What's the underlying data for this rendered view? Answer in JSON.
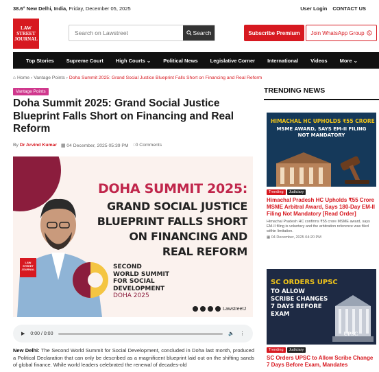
{
  "topbar": {
    "weather": "38.6° New Delhi, India,",
    "date": " Friday, December 05, 2025",
    "user_login": "User Login",
    "contact_us": "CONTACT US"
  },
  "logo": {
    "line1": "LAW",
    "line2": "STREET",
    "line3": "JOURNAL"
  },
  "search": {
    "placeholder": "Search on Lawstreet",
    "button": "Search"
  },
  "premium_button": "Subscribe Premium",
  "whatsapp_button": "Join WhatsApp Group",
  "nav": [
    "Top Stories",
    "Supreme Court",
    "High Courts",
    "Political News",
    "Legislative Corner",
    "International",
    "Videos",
    "More"
  ],
  "breadcrumb": {
    "home": "Home",
    "sep1": " › ",
    "section": "Vantage Points",
    "sep2": " › ",
    "current": "Doha Summit 2025: Grand Social Justice Blueprint Falls Short on Financing and Real Reform"
  },
  "article": {
    "tag": "Vantage Points",
    "title": "Doha Summit 2025: Grand Social Justice Blueprint Falls Short on Financing and Real Reform",
    "by": "By",
    "author": "Dr Arvind Kumar",
    "date": "04 December, 2025 05:39 PM",
    "comments": "0 Comments"
  },
  "hero": {
    "headline1": "DOHA SUMMIT 2025:",
    "headline2": "GRAND SOCIAL JUSTICE",
    "headline3": "BLUEPRINT FALLS SHORT",
    "headline4": "ON FINANCING AND",
    "headline5": "REAL REFORM",
    "summit1": "SECOND",
    "summit2": "WORLD SUMMIT",
    "summit3": "FOR SOCIAL",
    "summit4": "DEVELOPMENT",
    "summit5": "DOHA 2025",
    "handle": "LawstreetJ",
    "minilogo1": "LAW",
    "minilogo2": "STREET",
    "minilogo3": "JOURNAL"
  },
  "audio": {
    "time": "0:00 / 0:00"
  },
  "body": {
    "lead": "New Delhi:",
    "text": " The Second World Summit for Social Development, concluded in Doha last month, produced a Political Declaration that can only be described as a magnificent blueprint laid out on the shifting sands of global finance. While world leaders celebrated the renewal of decades-old"
  },
  "trending": {
    "heading": "TRENDING NEWS",
    "cards": [
      {
        "img_headline": "HIMACHAL HC UPHOLDS ₹55 CRORE",
        "img_sub": "MSME AWARD, SAYS EM-II FILING NOT MANDATORY",
        "badge1": "Trending",
        "badge2": "Judiciary",
        "title": "Himachal Pradesh HC Upholds ₹55 Crore MSME Arbitral Award, Says 180-Day EM-II Filing Not Mandatory [Read Order]",
        "desc": "Himachal Pradesh HC confirms ₹55 crore MSME award, says EM-II filing is voluntary and the arbitration reference was filed within limitation.",
        "date": "04 December, 2025 04:20 PM"
      },
      {
        "img_headline": "SC ORDERS UPSC",
        "img_sub": "TO ALLOW SCRIBE CHANGES 7 DAYS BEFORE EXAM",
        "img_caption": "UPSC",
        "badge1": "Trending",
        "badge2": "Judiciary",
        "title": "SC Orders UPSC to Allow Scribe Change 7 Days Before Exam, Mandates"
      }
    ]
  },
  "colors": {
    "brand_red": "#d71920",
    "nav_bg": "#111111",
    "tag_pink": "#d0388d",
    "hero_maroon": "#8b1d3d"
  }
}
